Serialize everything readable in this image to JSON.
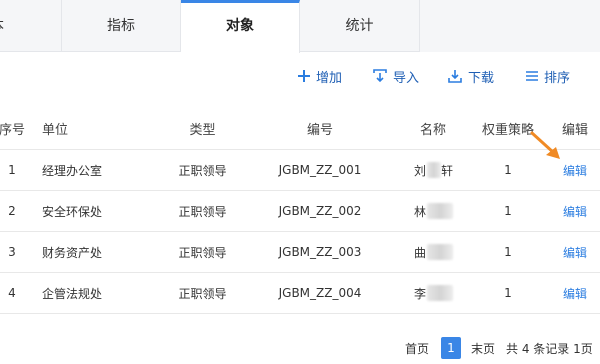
{
  "tabs": [
    {
      "label": "本",
      "active": false
    },
    {
      "label": "指标",
      "active": false
    },
    {
      "label": "对象",
      "active": true
    },
    {
      "label": "统计",
      "active": false
    }
  ],
  "toolbar": {
    "add": "增加",
    "import": "导入",
    "download": "下载",
    "sort": "排序"
  },
  "table": {
    "headers": {
      "seq": "序号",
      "unit": "单位",
      "type": "类型",
      "code": "编号",
      "name": "名称",
      "weight": "权重策略",
      "edit": "编辑"
    },
    "rows": [
      {
        "seq": "1",
        "unit": "经理办公室",
        "type": "正职领导",
        "code": "JGBM_ZZ_001",
        "name_first": "刘",
        "name_last": "轩",
        "weight": "1",
        "edit": "编辑"
      },
      {
        "seq": "2",
        "unit": "安全环保处",
        "type": "正职领导",
        "code": "JGBM_ZZ_002",
        "name_first": "林",
        "name_last": "",
        "weight": "1",
        "edit": "编辑"
      },
      {
        "seq": "3",
        "unit": "财务资产处",
        "type": "正职领导",
        "code": "JGBM_ZZ_003",
        "name_first": "曲",
        "name_last": "",
        "weight": "1",
        "edit": "编辑"
      },
      {
        "seq": "4",
        "unit": "企管法规处",
        "type": "正职领导",
        "code": "JGBM_ZZ_004",
        "name_first": "李",
        "name_last": "",
        "weight": "1",
        "edit": "编辑"
      }
    ]
  },
  "pagination": {
    "first": "首页",
    "current": "1",
    "last": "末页",
    "summary": "共 4 条记录 1页"
  },
  "colors": {
    "accent": "#3a86e6",
    "link": "#2b7de0",
    "annotation_arrow": "#f08a24"
  }
}
